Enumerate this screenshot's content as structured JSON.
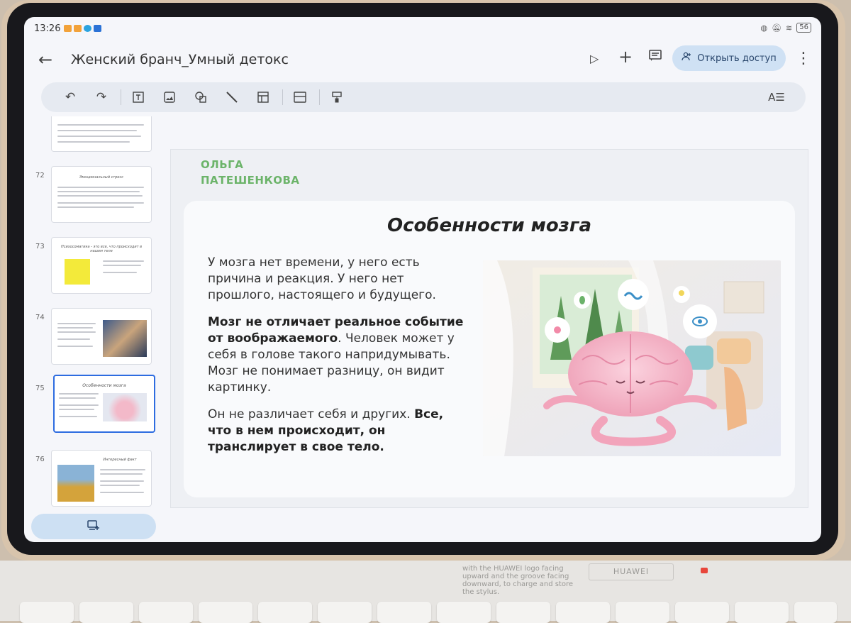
{
  "status": {
    "time": "13:26",
    "battery": "56"
  },
  "app": {
    "doc_title": "Женский бранч_Умный детокс",
    "share_label": "Открыть доступ"
  },
  "thumbs": [
    {
      "num": "",
      "title": ""
    },
    {
      "num": "72",
      "title": "Эмоциональный стресс"
    },
    {
      "num": "73",
      "title": "Психосоматика - это все, что происходит в нашем теле"
    },
    {
      "num": "74",
      "title": ""
    },
    {
      "num": "75",
      "title": "Особенности мозга"
    },
    {
      "num": "76",
      "title": "Интересный факт"
    }
  ],
  "slide": {
    "author_line1": "ОЛЬГА",
    "author_line2": "ПАТЕШЕНКОВА",
    "title": "Особенности мозга",
    "p1": "У мозга нет времени, у него есть причина и реакция. У него нет прошлого, настоящего и будущего.",
    "p2_bold": "Мозг не отличает реальное событие от воображаемого",
    "p2_rest": ". Человек может у себя в голове такого напридумывать. Мозг не понимает разницу, он видит картинку.",
    "p3_start": "Он не различает себя и других. ",
    "p3_bold": "Все, что в нем происходит, он транслирует в свое тело."
  },
  "keyboard": {
    "sticker_text": "with the HUAWEI logo facing upward and the groove facing downward, to charge and store the stylus.",
    "brand": "HUAWEI"
  },
  "colors": {
    "accent": "#2d6ce0",
    "author_green": "#6cb46a",
    "share_bg": "#cfe1f4"
  }
}
